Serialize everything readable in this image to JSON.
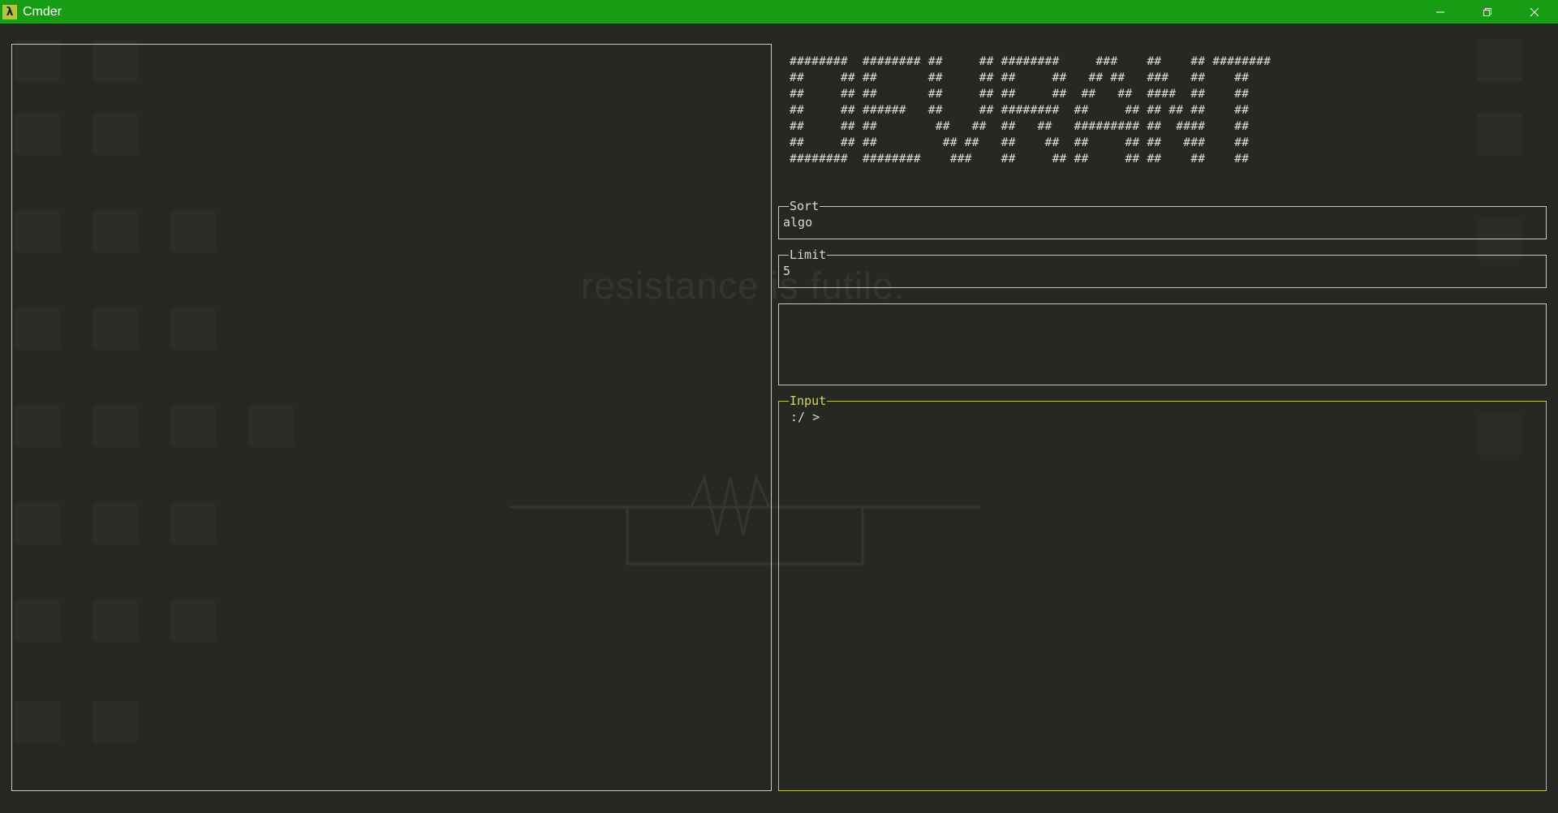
{
  "window": {
    "title": "Cmder",
    "app_icon_glyph": "λ",
    "controls": [
      "minimize",
      "restore",
      "close"
    ]
  },
  "background": {
    "watermark_text": "resistance is futile."
  },
  "banner": {
    "lines": [
      "########  ######## ##     ## ########     ###    ##    ## ########",
      "##     ## ##       ##     ## ##     ##   ## ##   ###   ##    ##",
      "##     ## ##       ##     ## ##     ##  ##   ##  ####  ##    ##",
      "##     ## ######   ##     ## ########  ##     ## ## ## ##    ##",
      "##     ## ##        ##   ##  ##   ##   ######### ##  ####    ##",
      "##     ## ##         ## ##   ##    ##  ##     ## ##   ###    ##",
      "########  ########    ###    ##     ## ##     ## ##    ##    ##"
    ]
  },
  "fields": {
    "sort": {
      "label": "Sort",
      "value": "algo"
    },
    "limit": {
      "label": "Limit",
      "value": "5"
    },
    "input": {
      "label": "Input",
      "prompt": ":/ >"
    }
  },
  "colors": {
    "titlebar": "#169d14",
    "background": "#262822",
    "border": "#c8c8c8",
    "input_accent": "#c0c447"
  }
}
